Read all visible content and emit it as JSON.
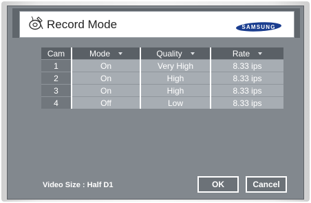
{
  "dialog": {
    "title": "Record Mode",
    "brand": "SAMSUNG"
  },
  "table": {
    "headers": [
      "Cam",
      "Mode",
      "Quality",
      "Rate"
    ],
    "rows": [
      {
        "cam": "1",
        "mode": "On",
        "quality": "Very High",
        "rate": "8.33 ips"
      },
      {
        "cam": "2",
        "mode": "On",
        "quality": "High",
        "rate": "8.33 ips"
      },
      {
        "cam": "3",
        "mode": "On",
        "quality": "High",
        "rate": "8.33 ips"
      },
      {
        "cam": "4",
        "mode": "Off",
        "quality": "Low",
        "rate": "8.33 ips"
      }
    ]
  },
  "footer": {
    "video_size": "Video Size : Half D1",
    "ok_label": "OK",
    "cancel_label": "Cancel"
  },
  "colors": {
    "panel_bg": "#82888e",
    "header_bg": "#5a6066",
    "cell_bg": "#a7adb3",
    "cam_cell_bg": "#71777d",
    "button_bg": "#6c7278",
    "brand_logo_bg": "#1a3d8f"
  },
  "icons": {
    "title": "record-settings-icon",
    "sort": "triangle-down-icon"
  }
}
